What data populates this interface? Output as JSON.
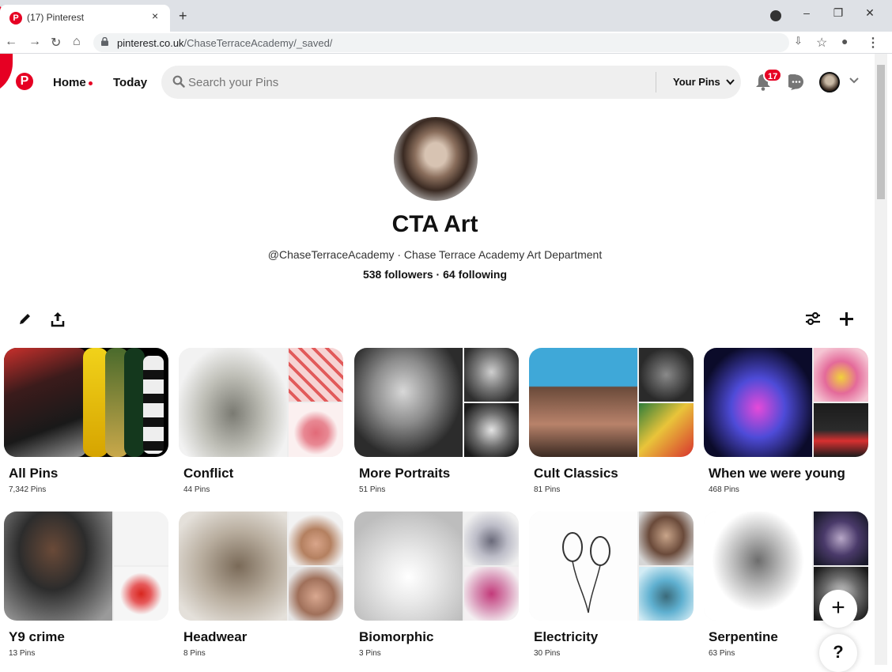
{
  "browser": {
    "tab_title": "(17) Pinterest",
    "tab_close": "×",
    "new_tab": "+",
    "url_domain": "pinterest.co.uk",
    "url_path": "/ChaseTerraceAcademy/_saved/"
  },
  "header": {
    "logo": "P",
    "nav_home": "Home",
    "nav_today": "Today",
    "search_placeholder": "Search your Pins",
    "scope_label": "Your Pins",
    "notification_count": "17"
  },
  "profile": {
    "name": "CTA Art",
    "handle_line": "@ChaseTerraceAcademy · Chase Terrace Academy Art Department",
    "stats_line": "538 followers · 64 following"
  },
  "boards": [
    {
      "name": "All Pins",
      "count": "7,342 Pins"
    },
    {
      "name": "Conflict",
      "count": "44 Pins"
    },
    {
      "name": "More Portraits",
      "count": "51 Pins"
    },
    {
      "name": "Cult Classics",
      "count": "81 Pins"
    },
    {
      "name": "When we were young",
      "count": "468 Pins"
    },
    {
      "name": "Y9 crime",
      "count": "13 Pins"
    },
    {
      "name": "Headwear",
      "count": "8 Pins"
    },
    {
      "name": "Biomorphic",
      "count": "3 Pins"
    },
    {
      "name": "Electricity",
      "count": "30 Pins"
    },
    {
      "name": "Serpentine",
      "count": "63 Pins"
    }
  ],
  "fab": {
    "add": "+",
    "help": "?"
  },
  "colors": {
    "brand": "#e60023",
    "search_bg": "#efefef"
  }
}
